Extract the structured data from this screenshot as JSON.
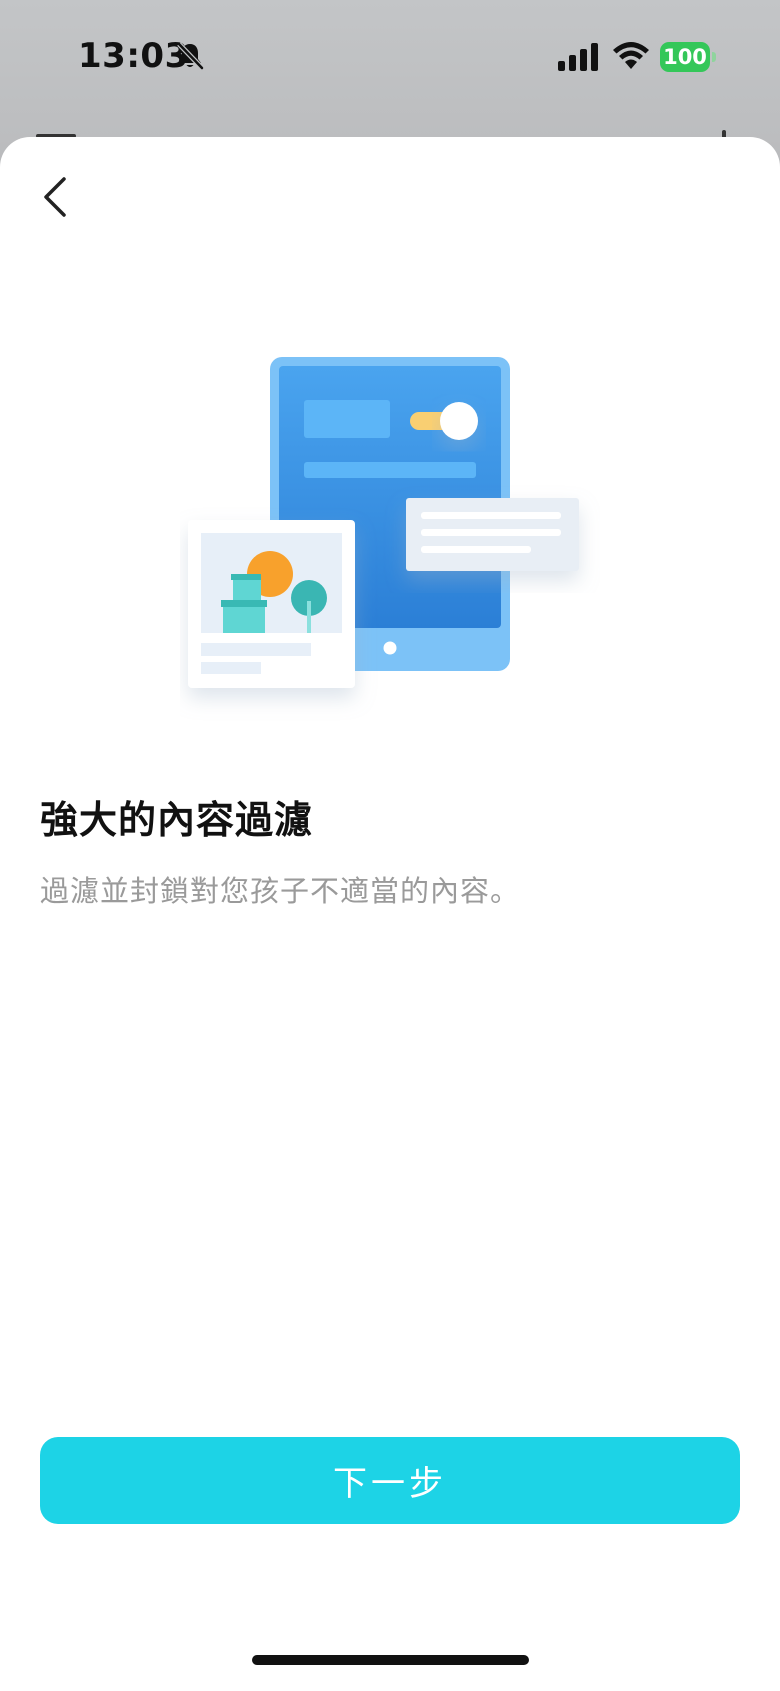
{
  "status_bar": {
    "time": "13:03",
    "battery_level": "100",
    "icons": [
      "bell-slash-icon",
      "cellular-signal-icon",
      "wifi-icon",
      "battery-icon"
    ],
    "battery_color": "#34c759"
  },
  "header": {
    "back_icon": "chevron-left-icon"
  },
  "content": {
    "illustration": "tablet-content-filter-illustration",
    "title": "強大的內容過濾",
    "description": "過濾並封鎖對您孩子不適當的內容。"
  },
  "footer": {
    "next_label": "下一步",
    "accent_color": "#1dd3e6"
  }
}
